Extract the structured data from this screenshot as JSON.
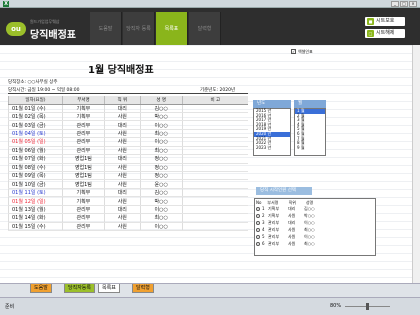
{
  "window": {
    "minimize": "_",
    "maximize": "□",
    "close": "×"
  },
  "header": {
    "logo": "ou",
    "subtitle": "원드가업업무웨삼",
    "title": "당직배정표",
    "tabs": [
      {
        "label": "도움말"
      },
      {
        "label": "당직자 등록"
      },
      {
        "label": "목록표"
      },
      {
        "label": "달력형"
      }
    ],
    "active_tab": 2,
    "print_button": "시트보호",
    "unprotect_button": "시트해제"
  },
  "option": {
    "label": "엑셀인표",
    "checked": true
  },
  "doc": {
    "title": "1월 당직배정표",
    "location": "당직장소: ○○사무실 상주",
    "time": "당직시간: 금일 19:00 ~ 익일 08:00",
    "base_year": "기준년도: 2020년"
  },
  "table": {
    "headers": [
      "일자(요일)",
      "부서명",
      "직 위",
      "성 명",
      "비 고"
    ],
    "rows": [
      {
        "date": "01월 01일 (수)",
        "dept": "기획부",
        "pos": "대리",
        "name": "김○○",
        "note": "",
        "color": "black"
      },
      {
        "date": "01월 02일 (목)",
        "dept": "기획부",
        "pos": "사원",
        "name": "박○○",
        "note": "",
        "color": "black"
      },
      {
        "date": "01월 03일 (금)",
        "dept": "관리부",
        "pos": "대리",
        "name": "이○○",
        "note": "",
        "color": "black"
      },
      {
        "date": "01월 04일 (토)",
        "dept": "관리부",
        "pos": "사원",
        "name": "최○○",
        "note": "",
        "color": "blue"
      },
      {
        "date": "01월 05일 (일)",
        "dept": "관리부",
        "pos": "사원",
        "name": "이○○",
        "note": "",
        "color": "red"
      },
      {
        "date": "01월 06일 (월)",
        "dept": "관리부",
        "pos": "사원",
        "name": "최○○",
        "note": "",
        "color": "black"
      },
      {
        "date": "01월 07일 (화)",
        "dept": "영업1팀",
        "pos": "대리",
        "name": "정○○",
        "note": "",
        "color": "black"
      },
      {
        "date": "01월 08일 (수)",
        "dept": "영업1팀",
        "pos": "사원",
        "name": "정○○",
        "note": "",
        "color": "black"
      },
      {
        "date": "01월 09일 (목)",
        "dept": "영업1팀",
        "pos": "사원",
        "name": "정○○",
        "note": "",
        "color": "black"
      },
      {
        "date": "01월 10일 (금)",
        "dept": "영업1팀",
        "pos": "사원",
        "name": "윤○○",
        "note": "",
        "color": "black"
      },
      {
        "date": "01월 11일 (토)",
        "dept": "기획부",
        "pos": "대리",
        "name": "김○○",
        "note": "",
        "color": "blue"
      },
      {
        "date": "01월 12일 (일)",
        "dept": "기획부",
        "pos": "사원",
        "name": "박○○",
        "note": "",
        "color": "red"
      },
      {
        "date": "01월 13일 (월)",
        "dept": "관리부",
        "pos": "대리",
        "name": "이○○",
        "note": "",
        "color": "black"
      },
      {
        "date": "01월 14일 (화)",
        "dept": "관리부",
        "pos": "사원",
        "name": "최○○",
        "note": "",
        "color": "black"
      },
      {
        "date": "01월 15일 (수)",
        "dept": "관리부",
        "pos": "사원",
        "name": "이○○",
        "note": "",
        "color": "black"
      }
    ]
  },
  "year_panel": {
    "title": "년도",
    "items": [
      "2015 년",
      "2016 년",
      "2017 년",
      "2018 년",
      "2019 년",
      "2020 년",
      "2021 년",
      "2022 년",
      "2023 년"
    ],
    "selected": 5
  },
  "month_panel": {
    "title": "월",
    "items": [
      "1 월",
      "2 월",
      "3 월",
      "4 월",
      "5 월",
      "6 월",
      "7 월",
      "8 월",
      "9 월"
    ],
    "selected": 0
  },
  "start_select": {
    "label": "당직 시작인원 선택"
  },
  "employees": {
    "headers": [
      "No",
      "부서명",
      "직위",
      "성명"
    ],
    "rows": [
      {
        "no": "1",
        "dept": "기획부",
        "pos": "대리",
        "name": "김○○"
      },
      {
        "no": "2",
        "dept": "기획부",
        "pos": "사원",
        "name": "박○○"
      },
      {
        "no": "3",
        "dept": "관리부",
        "pos": "대리",
        "name": "이○○"
      },
      {
        "no": "4",
        "dept": "관리부",
        "pos": "사원",
        "name": "최○○"
      },
      {
        "no": "5",
        "dept": "관리부",
        "pos": "사원",
        "name": "이○○"
      },
      {
        "no": "6",
        "dept": "관리부",
        "pos": "사원",
        "name": "최○○"
      }
    ]
  },
  "sheets": [
    {
      "label": "도움말",
      "color": "#f0a030"
    },
    {
      "label": "당직자등록",
      "color": "#9bbf2a"
    },
    {
      "label": "목록표",
      "color": "#ffffff"
    },
    {
      "label": "달력형",
      "color": "#f0a030"
    }
  ],
  "status": {
    "ready": "준비",
    "zoom": "80%"
  }
}
